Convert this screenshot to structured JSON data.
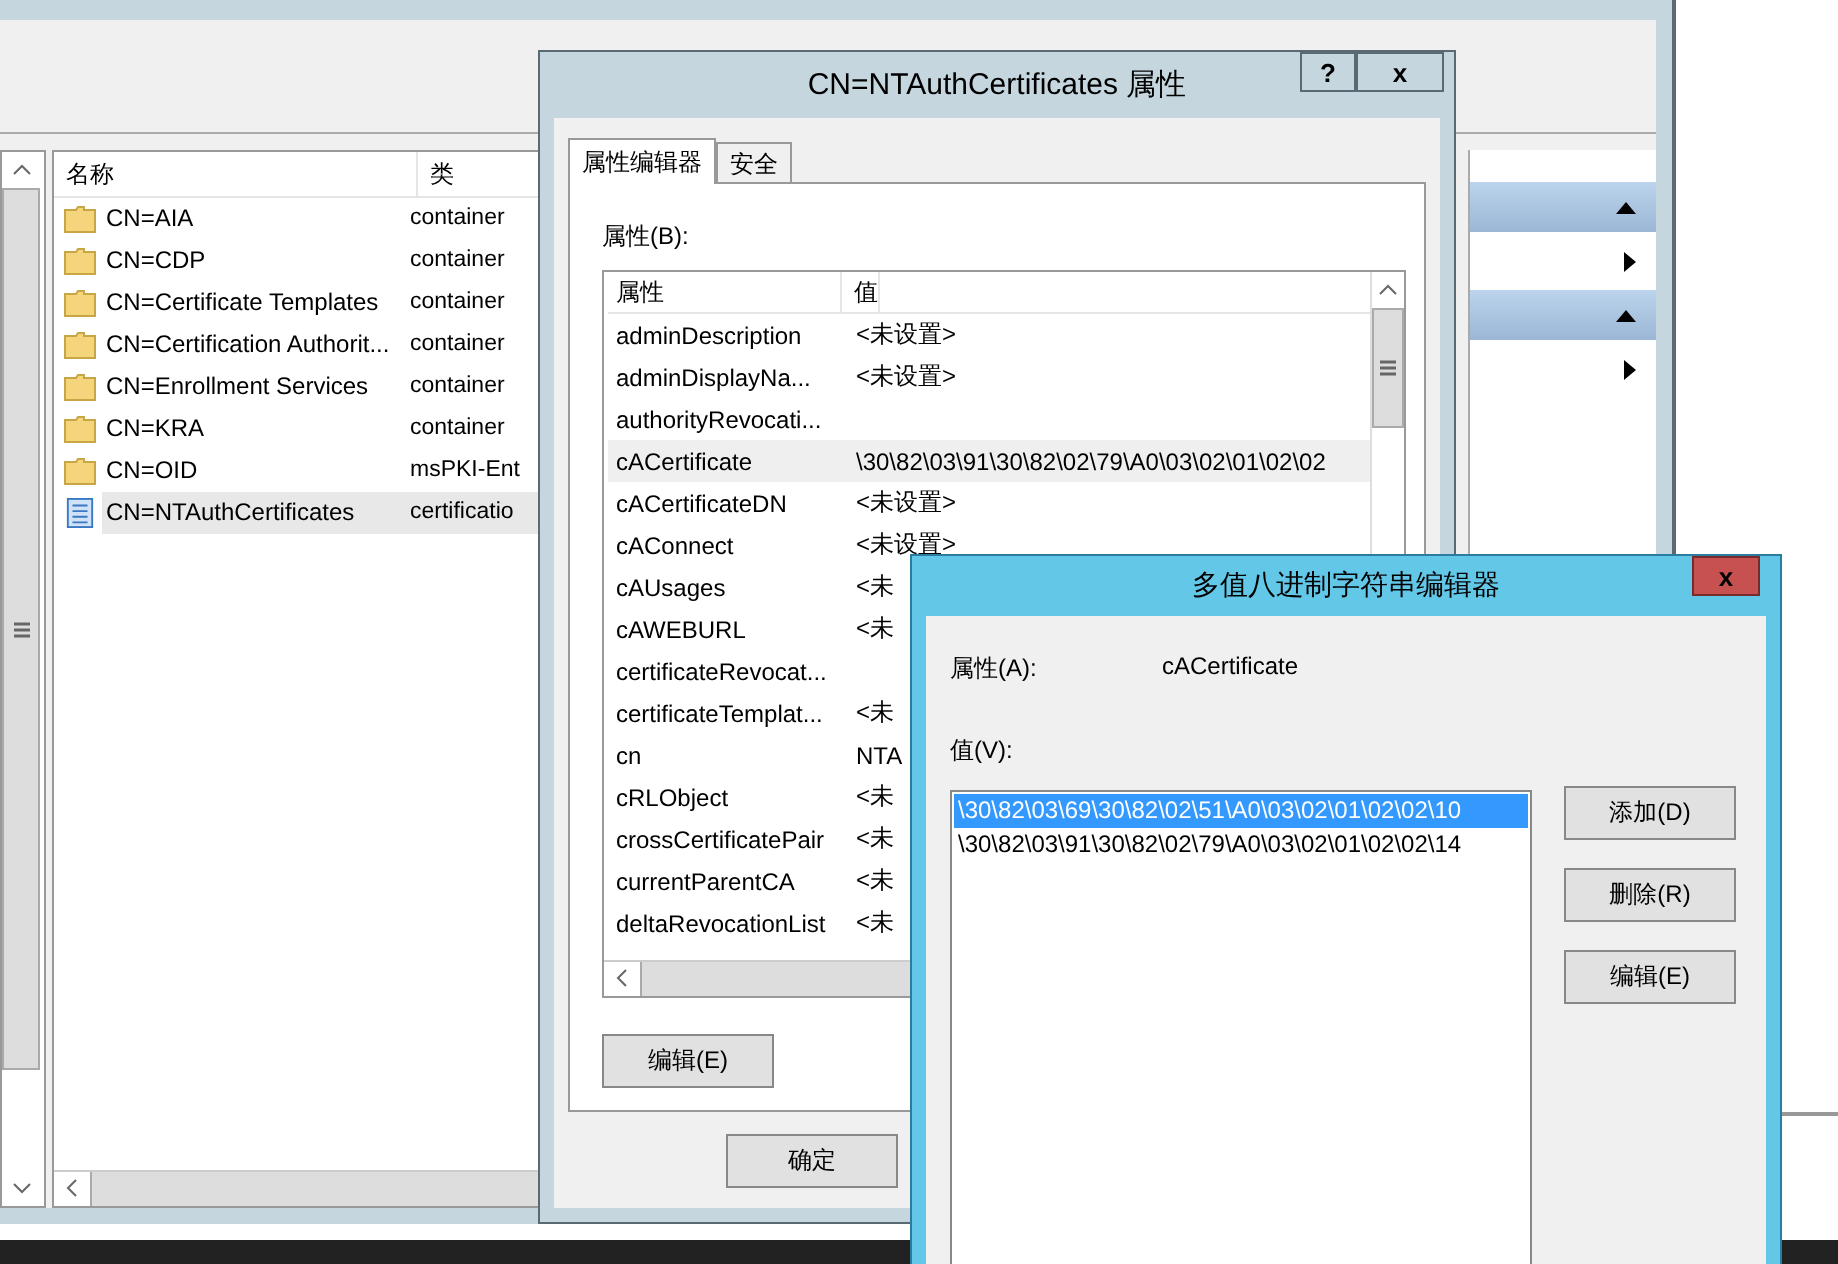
{
  "main_window": {
    "list": {
      "columns": [
        "名称",
        "类"
      ],
      "rows": [
        {
          "name": "CN=AIA",
          "type": "container",
          "kind": "folder",
          "selected": false
        },
        {
          "name": "CN=CDP",
          "type": "container",
          "kind": "folder",
          "selected": false
        },
        {
          "name": "CN=Certificate Templates",
          "type": "container",
          "kind": "folder",
          "selected": false
        },
        {
          "name": "CN=Certification Authorit...",
          "type": "container",
          "kind": "folder",
          "selected": false
        },
        {
          "name": "CN=Enrollment Services",
          "type": "container",
          "kind": "folder",
          "selected": false
        },
        {
          "name": "CN=KRA",
          "type": "container",
          "kind": "folder",
          "selected": false
        },
        {
          "name": "CN=OID",
          "type": "msPKI-Ent",
          "kind": "folder",
          "selected": false
        },
        {
          "name": "CN=NTAuthCertificates",
          "type": "certificatio",
          "kind": "document",
          "selected": true
        }
      ]
    },
    "action_pane": {
      "sections": [
        {
          "expanded": true
        },
        {
          "expanded": true
        }
      ]
    }
  },
  "properties_dialog": {
    "title": "CN=NTAuthCertificates 属性",
    "help_button": "?",
    "close_button": "x",
    "tabs": [
      {
        "label": "属性编辑器",
        "selected": true
      },
      {
        "label": "安全",
        "selected": false
      }
    ],
    "attributes_label": "属性(B):",
    "columns": [
      "属性",
      "值"
    ],
    "rows": [
      {
        "attribute": "adminDescription",
        "value": "<未设置>",
        "selected": false
      },
      {
        "attribute": "adminDisplayNa...",
        "value": "<未设置>",
        "selected": false
      },
      {
        "attribute": "authorityRevocati...",
        "value": "",
        "selected": false
      },
      {
        "attribute": "cACertificate",
        "value": "\\30\\82\\03\\91\\30\\82\\02\\79\\A0\\03\\02\\01\\02\\02",
        "selected": true
      },
      {
        "attribute": "cACertificateDN",
        "value": "<未设置>",
        "selected": false
      },
      {
        "attribute": "cAConnect",
        "value": "<未设置>",
        "selected": false
      },
      {
        "attribute": "cAUsages",
        "value": "<未",
        "selected": false
      },
      {
        "attribute": "cAWEBURL",
        "value": "<未",
        "selected": false
      },
      {
        "attribute": "certificateRevocat...",
        "value": "",
        "selected": false
      },
      {
        "attribute": "certificateTemplat...",
        "value": "<未",
        "selected": false
      },
      {
        "attribute": "cn",
        "value": "NTA",
        "selected": false
      },
      {
        "attribute": "cRLObject",
        "value": "<未",
        "selected": false
      },
      {
        "attribute": "crossCertificatePair",
        "value": "<未",
        "selected": false
      },
      {
        "attribute": "currentParentCA",
        "value": "<未",
        "selected": false
      },
      {
        "attribute": "deltaRevocationList",
        "value": "<未",
        "selected": false
      }
    ],
    "edit_button": "编辑(E)",
    "ok_button": "确定"
  },
  "multivalue_dialog": {
    "title": "多值八进制字符串编辑器",
    "close_button": "x",
    "attribute_label": "属性(A):",
    "attribute_value": "cACertificate",
    "values_label": "值(V):",
    "values": [
      {
        "text": "\\30\\82\\03\\69\\30\\82\\02\\51\\A0\\03\\02\\01\\02\\02\\10",
        "selected": true
      },
      {
        "text": "\\30\\82\\03\\91\\30\\82\\02\\79\\A0\\03\\02\\01\\02\\02\\14",
        "selected": false
      }
    ],
    "buttons": [
      "添加(D)",
      "删除(R)",
      "编辑(E)"
    ]
  }
}
